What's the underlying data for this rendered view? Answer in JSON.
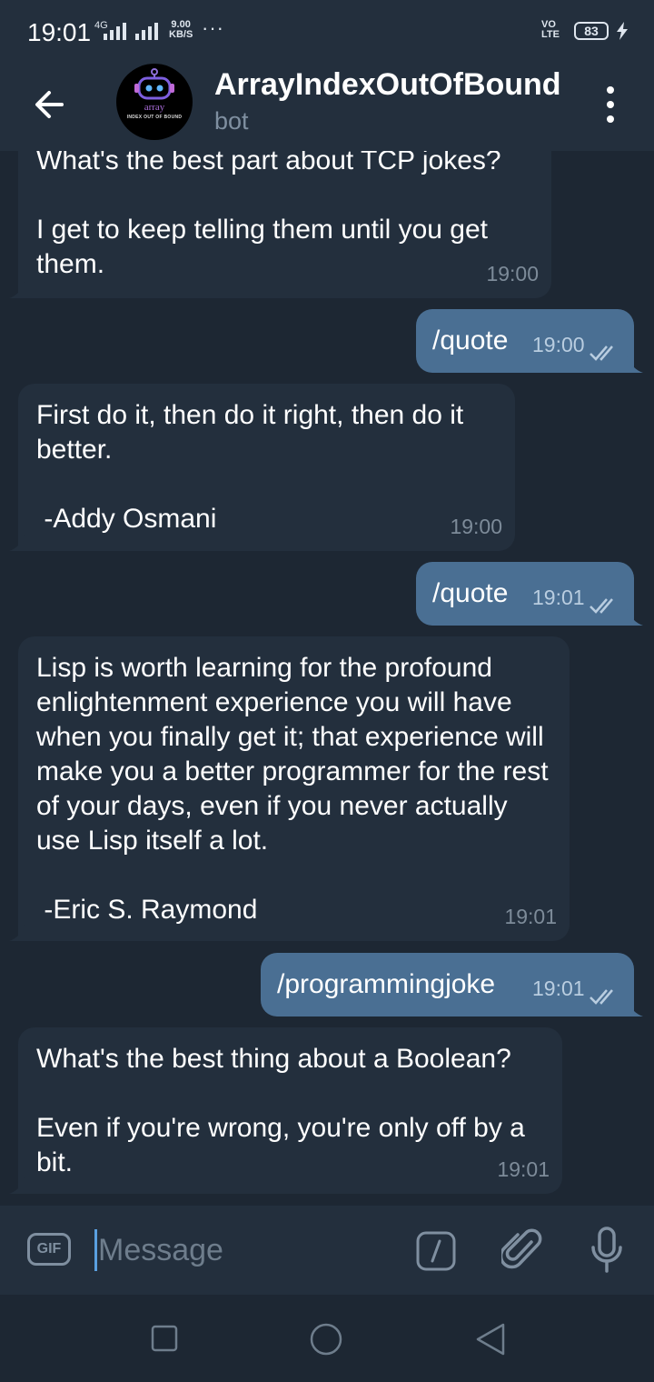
{
  "status_bar": {
    "time": "19:01",
    "network": "4G",
    "speed_value": "9.00",
    "speed_unit": "KB/S",
    "overflow": "···",
    "volte_top": "VO",
    "volte_bottom": "LTE",
    "battery": "83"
  },
  "header": {
    "title": "ArrayIndexOutOfBound",
    "subtitle": "bot",
    "avatar_line1": "array",
    "avatar_line2": "INDEX OUT OF BOUND"
  },
  "messages": [
    {
      "dir": "in",
      "text": "What's the best part about TCP jokes?\n\nI get to keep telling them until you get them.",
      "time": "19:00"
    },
    {
      "dir": "out",
      "text": "/quote",
      "time": "19:00",
      "read": true
    },
    {
      "dir": "in",
      "text": "First do it, then do it right, then do it better.\n\n -Addy Osmani",
      "time": "19:00"
    },
    {
      "dir": "out",
      "text": "/quote",
      "time": "19:01",
      "read": true
    },
    {
      "dir": "in",
      "text": "Lisp is worth learning for the profound enlightenment experience you will have when you finally get it; that experience will make you a better programmer for the rest of your days, even if you never actually use Lisp itself a lot.\n\n -Eric S. Raymond",
      "time": "19:01"
    },
    {
      "dir": "out",
      "text": "/programmingjoke",
      "time": "19:01",
      "read": true
    },
    {
      "dir": "in",
      "text": "What's the best thing about a Boolean?\n\nEven if you're wrong, you're only off by a bit.",
      "time": "19:01"
    }
  ],
  "input_bar": {
    "gif_label": "GIF",
    "placeholder": "Message"
  },
  "colors": {
    "background": "#1d2733",
    "panel": "#232f3d",
    "incoming_bubble": "#232f3d",
    "outgoing_bubble": "#4a6f93",
    "accent": "#5aa0e0"
  }
}
